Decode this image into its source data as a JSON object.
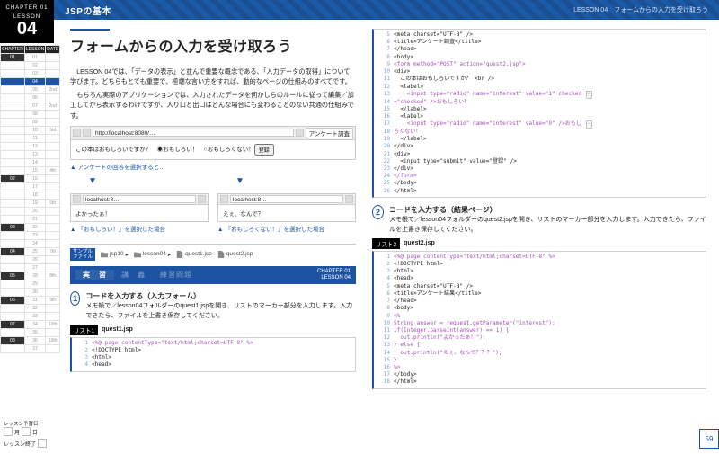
{
  "rail": {
    "chapter_kicker": "CHAPTER 01",
    "lesson_label": "LESSON",
    "lesson_number": "04",
    "cols": [
      "CHAPTER",
      "LESSON",
      "DATE"
    ],
    "rows": [
      {
        "c": "01",
        "l": "01",
        "d": "",
        "ch": true
      },
      {
        "c": "",
        "l": "02",
        "d": ""
      },
      {
        "c": "",
        "l": "03",
        "d": ""
      },
      {
        "c": "",
        "l": "04",
        "d": "",
        "cur": true
      },
      {
        "c": "",
        "l": "05",
        "d": "2nd"
      },
      {
        "c": "",
        "l": "06",
        "d": ""
      },
      {
        "c": "",
        "l": "07",
        "d": "2nd"
      },
      {
        "c": "",
        "l": "08",
        "d": ""
      },
      {
        "c": "",
        "l": "09",
        "d": ""
      },
      {
        "c": "",
        "l": "10",
        "d": "3rd"
      },
      {
        "c": "",
        "l": "11",
        "d": ""
      },
      {
        "c": "",
        "l": "12",
        "d": ""
      },
      {
        "c": "",
        "l": "13",
        "d": ""
      },
      {
        "c": "",
        "l": "14",
        "d": ""
      },
      {
        "c": "",
        "l": "15",
        "d": "4th"
      },
      {
        "c": "02",
        "l": "16",
        "d": "",
        "ch": true
      },
      {
        "c": "",
        "l": "17",
        "d": ""
      },
      {
        "c": "",
        "l": "18",
        "d": ""
      },
      {
        "c": "",
        "l": "19",
        "d": "5th"
      },
      {
        "c": "",
        "l": "20",
        "d": ""
      },
      {
        "c": "",
        "l": "21",
        "d": ""
      },
      {
        "c": "03",
        "l": "22",
        "d": "",
        "ch": true
      },
      {
        "c": "",
        "l": "23",
        "d": ""
      },
      {
        "c": "",
        "l": "24",
        "d": ""
      },
      {
        "c": "04",
        "l": "25",
        "d": "7th",
        "ch": true
      },
      {
        "c": "",
        "l": "26",
        "d": ""
      },
      {
        "c": "",
        "l": "27",
        "d": ""
      },
      {
        "c": "05",
        "l": "28",
        "d": "8th",
        "ch": true
      },
      {
        "c": "",
        "l": "29",
        "d": ""
      },
      {
        "c": "",
        "l": "30",
        "d": ""
      },
      {
        "c": "06",
        "l": "31",
        "d": "9th",
        "ch": true
      },
      {
        "c": "",
        "l": "32",
        "d": ""
      },
      {
        "c": "",
        "l": "33",
        "d": ""
      },
      {
        "c": "07",
        "l": "34",
        "d": "10th",
        "ch": true
      },
      {
        "c": "",
        "l": "35",
        "d": ""
      },
      {
        "c": "08",
        "l": "36",
        "d": "10th",
        "ch": true
      },
      {
        "c": "",
        "l": "37",
        "d": ""
      }
    ],
    "status1": "レッスン予習日",
    "status2": "レッスン終了"
  },
  "hdr": {
    "title": "JSPの基本",
    "right": "LESSON 04　フォームからの入力を受け取ろう"
  },
  "lesson": {
    "title": "フォームからの入力を受け取ろう",
    "lead1": "LESSON 04では、「データの表示」と並んで重要な概念である、「入力データの取得」について学びます。どちらもとても重要で、極端な言い方をすれば、動的なページの仕組みのすべてです。",
    "lead2": "もちろん実際のアプリケーションでは、入力されたデータを何かしらのルールに従って編集／加工してから表示するわけですが、入り口と出口はどんな場合にも変わることのない共通の仕組みです。"
  },
  "browser1": {
    "url": "http://localhost:8080/…",
    "tab": "アンケート調査",
    "body_text": "この本はおもしろいですか？　◉おもしろい！　○おもしろくない！",
    "btn": "登録"
  },
  "caption1": "アンケートの回答を選択すると…",
  "browser2a": {
    "url": "localhost:8…",
    "body": "よかったぁ！"
  },
  "browser2b": {
    "url": "localhost:8…",
    "body": "えぇ、なんで？"
  },
  "caption2a": "「おもしろい！」を選択した場合",
  "caption2b": "「おもしろくない！」を選択した場合",
  "crumbs": {
    "tag": "サンプル\nファイル",
    "items": [
      "jsp10",
      "lesson04",
      "quest1.jsp",
      "quest2.jsp"
    ]
  },
  "tabs": {
    "t1": "実　習",
    "t2": "講　義",
    "t3": "練習問題",
    "right1": "CHAPTER 01",
    "right2": "LESSON 04"
  },
  "step1": {
    "num": "1",
    "title": "コードを入力する（入力フォーム）",
    "desc": "メモ帳で／lesson04フォルダーのquest1.jspを開き、リストのマーカー部分を入力します。入力できたら、ファイルを上書き保存してください。"
  },
  "listing1": {
    "badge": "リスト1",
    "file": "quest1.jsp"
  },
  "code1": [
    {
      "t": "<%@ page contentType=\"text/html;charset=UTF-8\" %>",
      "hl": true
    },
    {
      "t": "<!DOCTYPE html>"
    },
    {
      "t": "<html>"
    },
    {
      "t": "<head>"
    }
  ],
  "code_top": [
    {
      "t": "<meta charset=\"UTF-8\" />"
    },
    {
      "t": "<title>アンケート調査</title>"
    },
    {
      "t": "</head>"
    },
    {
      "t": "<body>"
    },
    {
      "t": "<form method=\"POST\" action=\"quest2.jsp\">",
      "hl": true
    },
    {
      "t": "<div>"
    },
    {
      "t": "  この本はおもしろいですか？ <br />"
    },
    {
      "t": "  <label>"
    },
    {
      "t": "    <input type=\"radio\" name=\"interest\" value=\"1\" checked ",
      "hl": true,
      "wrap": true
    },
    {
      "t": "=\"checked\" />おもしろい！",
      "hl": true
    },
    {
      "t": "  </label>"
    },
    {
      "t": "  <label>"
    },
    {
      "t": "    <input type=\"radio\" name=\"interest\" value=\"0\" />おもし ",
      "hl": true,
      "wrap": true
    },
    {
      "t": "ろくない！",
      "hl": true
    },
    {
      "t": "  </label>"
    },
    {
      "t": "</div>"
    },
    {
      "t": "<div>"
    },
    {
      "t": "  <input type=\"submit\" value=\"登録\" />"
    },
    {
      "t": "</div>"
    },
    {
      "t": "</form>",
      "hl": true
    },
    {
      "t": "</body>"
    },
    {
      "t": "</html>"
    }
  ],
  "code_top_start": 5,
  "step2": {
    "num": "2",
    "title": "コードを入力する（結果ページ）",
    "desc": "メモ帳で／lesson04フォルダーのquest2.jspを開き、リストのマーカー部分を入力します。入力できたら、ファイルを上書き保存してください。"
  },
  "listing2": {
    "badge": "リスト2",
    "file": "quest2.jsp"
  },
  "code2": [
    {
      "t": "<%@ page contentType=\"text/html;charset=UTF-8\" %>",
      "hl": true
    },
    {
      "t": "<!DOCTYPE html>"
    },
    {
      "t": "<html>"
    },
    {
      "t": "<head>"
    },
    {
      "t": "<meta charset=\"UTF-8\" />"
    },
    {
      "t": "<title>アンケート結果</title>"
    },
    {
      "t": "</head>"
    },
    {
      "t": "<body>"
    },
    {
      "t": "<%",
      "hl": true
    },
    {
      "t": "String answer = request.getParameter(\"interest\");",
      "hl": true
    },
    {
      "t": "if(Integer.parseInt(answer) == 1) {",
      "hl": true
    },
    {
      "t": "  out.println(\"よかったぁ！\");",
      "hl": true
    },
    {
      "t": "} else {",
      "hl": true
    },
    {
      "t": "  out.println(\"えぇ、なんで？？？\");",
      "hl": true
    },
    {
      "t": "}",
      "hl": true
    },
    {
      "t": "%>",
      "hl": true
    },
    {
      "t": "</body>"
    },
    {
      "t": "</html>"
    }
  ],
  "page_number": "59"
}
